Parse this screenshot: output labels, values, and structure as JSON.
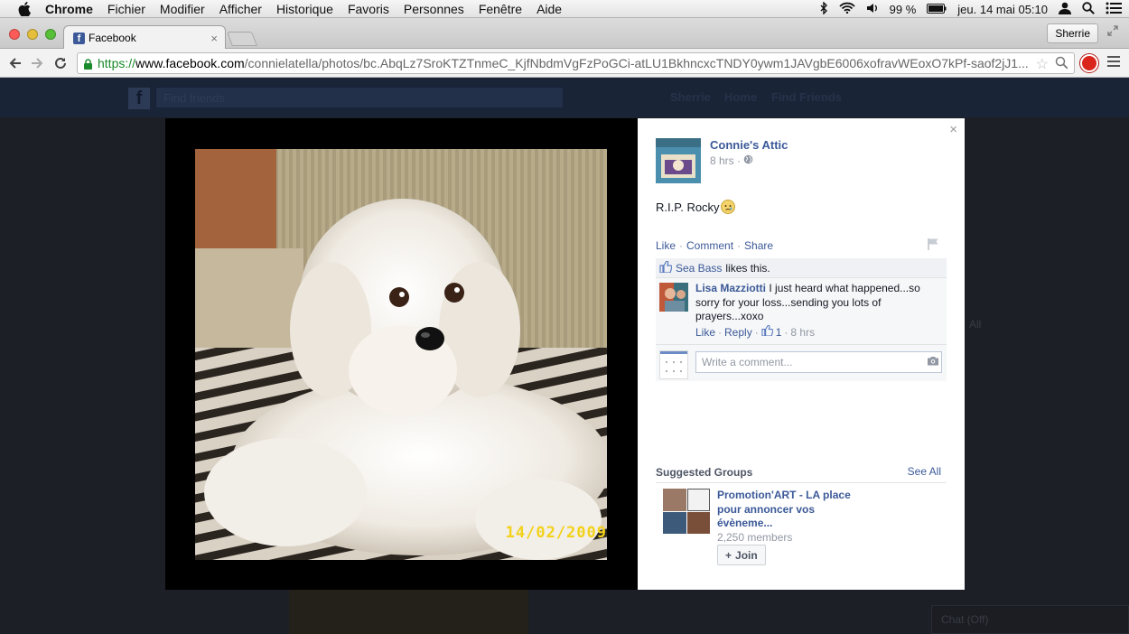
{
  "menubar": {
    "app": "Chrome",
    "items": [
      "Fichier",
      "Modifier",
      "Afficher",
      "Historique",
      "Favoris",
      "Personnes",
      "Fenêtre",
      "Aide"
    ],
    "battery": "99 %",
    "datetime": "jeu. 14 mai  05:10"
  },
  "browser": {
    "tab_title": "Facebook",
    "profile_button": "Sherrie",
    "url_scheme": "https://",
    "url_host": "www.facebook.com",
    "url_path": "/connielatella/photos/bc.AbqLz7SroKTZTnmeC_KjfNbdmVgFzPoGCi-atLU1BkhncxcTNDY0ywm1JAVgbE6006xofravWEoxO7kPf-saof2jJ1..."
  },
  "fb_bar": {
    "search_placeholder": "Find friends",
    "user": "Sherrie",
    "home": "Home",
    "find_friends": "Find Friends"
  },
  "photo": {
    "datestamp": "14/02/2009"
  },
  "post": {
    "page_name": "Connie's Attic",
    "time": "8 hrs ·",
    "text": "R.I.P. Rocky",
    "actions": [
      "Like",
      "Comment",
      "Share"
    ],
    "likes": {
      "name": "Sea Bass",
      "rest": "likes this."
    },
    "comment": {
      "author": "Lisa Mazziotti",
      "text": "I just heard what happened...so sorry for your loss...sending you lots of prayers...xoxo",
      "like": "Like",
      "reply": "Reply",
      "like_count": "1",
      "time": "8 hrs"
    },
    "write_placeholder": "Write a comment..."
  },
  "suggested": {
    "title": "Suggested Groups",
    "see_all": "See All",
    "group_name": "Promotion'ART - LA place pour annoncer vos évèneme...",
    "members": "2,250 members",
    "join": "Join"
  },
  "background": {
    "chat": "Chat (Off)",
    "all": "All"
  },
  "colors": {
    "facebook_blue": "#3b5998",
    "link": "#3b5998",
    "meta_gray": "#9197a3"
  }
}
